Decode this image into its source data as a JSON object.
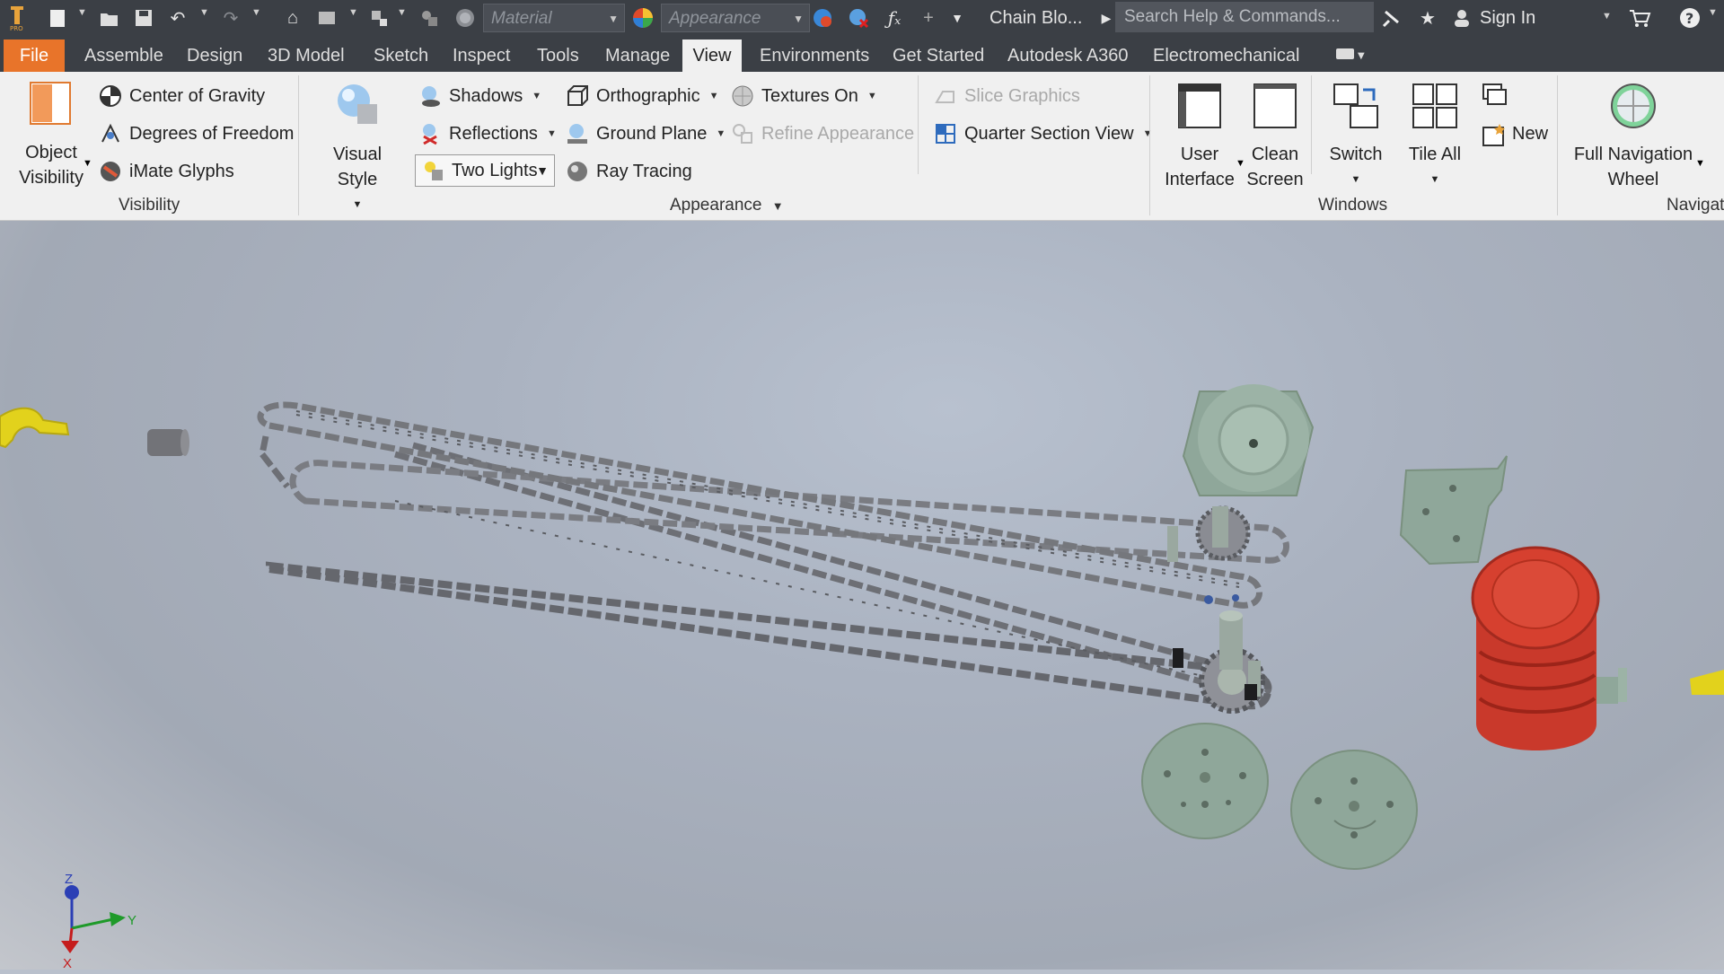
{
  "qat": {
    "material_placeholder": "Material",
    "appearance_placeholder": "Appearance",
    "doc_title": "Chain Blo...",
    "search_placeholder": "Search Help & Commands...",
    "sign_in": "Sign In",
    "icons": [
      "app-logo-icon",
      "new-icon",
      "open-icon",
      "save-icon",
      "undo-icon",
      "redo-icon",
      "home-icon",
      "return-icon",
      "select-icon",
      "update-icon",
      "material-icon",
      "appearance-icon",
      "clear-appearance-icon",
      "fx-icon",
      "plus-icon",
      "customize-icon",
      "cart-icon",
      "help-icon"
    ]
  },
  "menu": {
    "tabs": [
      "File",
      "Assemble",
      "Design",
      "3D Model",
      "Sketch",
      "Inspect",
      "Tools",
      "Manage",
      "View",
      "Environments",
      "Get Started",
      "Autodesk A360",
      "Electromechanical"
    ],
    "active": "View"
  },
  "ribbon": {
    "visibility": {
      "object_visibility": "Object\nVisibility",
      "object_visibility_l1": "Object",
      "object_visibility_l2": "Visibility",
      "center_of_gravity": "Center of Gravity",
      "degrees_of_freedom": "Degrees of Freedom",
      "imate_glyphs": "iMate Glyphs",
      "label": "Visibility"
    },
    "appearance": {
      "visual_style": "Visual Style",
      "shadows": "Shadows",
      "reflections": "Reflections",
      "two_lights": "Two Lights",
      "orthographic": "Orthographic",
      "ground_plane": "Ground Plane",
      "ray_tracing": "Ray Tracing",
      "textures_on": "Textures On",
      "refine_appearance": "Refine Appearance",
      "slice_graphics": "Slice Graphics",
      "quarter_section_view": "Quarter Section View",
      "label": "Appearance"
    },
    "windows": {
      "user_interface_l1": "User",
      "user_interface_l2": "Interface",
      "clean_screen_l1": "Clean",
      "clean_screen_l2": "Screen",
      "switch": "Switch",
      "tile_all": "Tile All",
      "new": "New",
      "label": "Windows"
    },
    "navigate": {
      "full_nav_l1": "Full Navigation",
      "full_nav_l2": "Wheel",
      "label": "Navigat"
    }
  },
  "viewport": {
    "triad": {
      "z": "Z",
      "y": "Y",
      "x": "X"
    },
    "colors": {
      "chain": "#6d6f75",
      "parts": "#8fa79a",
      "drum": "#c9392b",
      "hook": "#e2d21c"
    }
  }
}
